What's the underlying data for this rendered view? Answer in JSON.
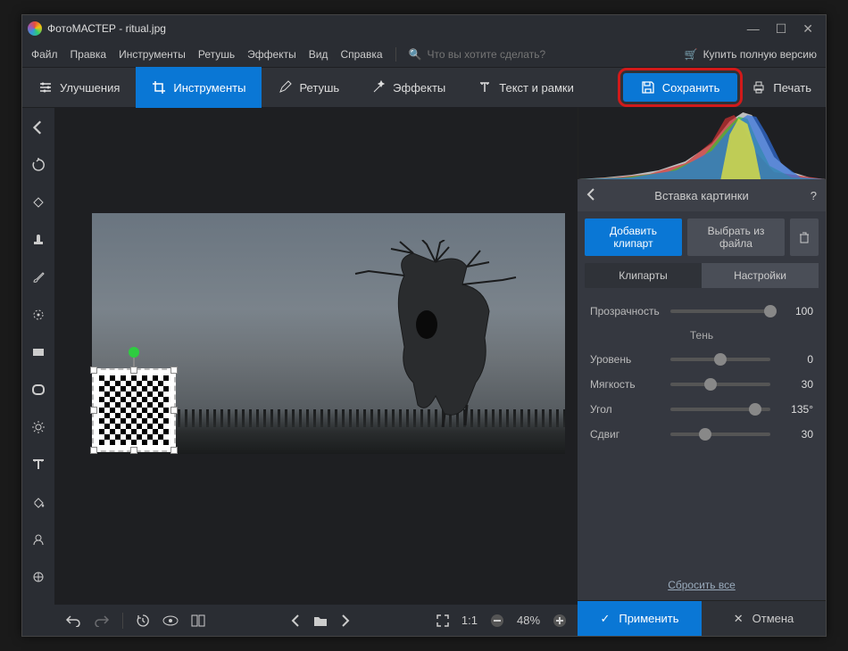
{
  "window": {
    "title": "ФотоМАСТЕР - ritual.jpg"
  },
  "winbtns": {
    "min": "—",
    "max": "☐",
    "close": "✕"
  },
  "menu": {
    "items": [
      "Файл",
      "Правка",
      "Инструменты",
      "Ретушь",
      "Эффекты",
      "Вид",
      "Справка"
    ],
    "search_placeholder": "Что вы хотите сделать?",
    "buy": "Купить полную версию"
  },
  "toolbar": {
    "tabs": [
      {
        "label": "Улучшения",
        "icon": "sliders-icon"
      },
      {
        "label": "Инструменты",
        "icon": "crop-icon",
        "active": true
      },
      {
        "label": "Ретушь",
        "icon": "brush-icon"
      },
      {
        "label": "Эффекты",
        "icon": "wand-icon"
      },
      {
        "label": "Текст и рамки",
        "icon": "text-icon"
      }
    ],
    "save": "Сохранить",
    "print": "Печать"
  },
  "verttools": [
    "back",
    "rotate",
    "heal",
    "stamp",
    "brush",
    "radial",
    "gradient",
    "vignette",
    "brightness",
    "text",
    "fill",
    "portrait",
    "shape"
  ],
  "bottombar": {
    "zoom_label": "1:1",
    "zoom_value": "48%"
  },
  "panel": {
    "title": "Вставка картинки",
    "add_clipart": "Добавить клипарт",
    "from_file": "Выбрать из файла",
    "subtabs": {
      "cliparts": "Клипарты",
      "settings": "Настройки"
    },
    "shadow_label": "Тень",
    "sliders": [
      {
        "label": "Прозрачность",
        "value": "100",
        "pos": 100
      },
      {
        "label": "Уровень",
        "value": "0",
        "pos": 50
      },
      {
        "label": "Мягкость",
        "value": "30",
        "pos": 40
      },
      {
        "label": "Угол",
        "value": "135°",
        "pos": 85
      },
      {
        "label": "Сдвиг",
        "value": "30",
        "pos": 35
      }
    ],
    "reset": "Сбросить все",
    "apply": "Применить",
    "cancel": "Отмена"
  }
}
